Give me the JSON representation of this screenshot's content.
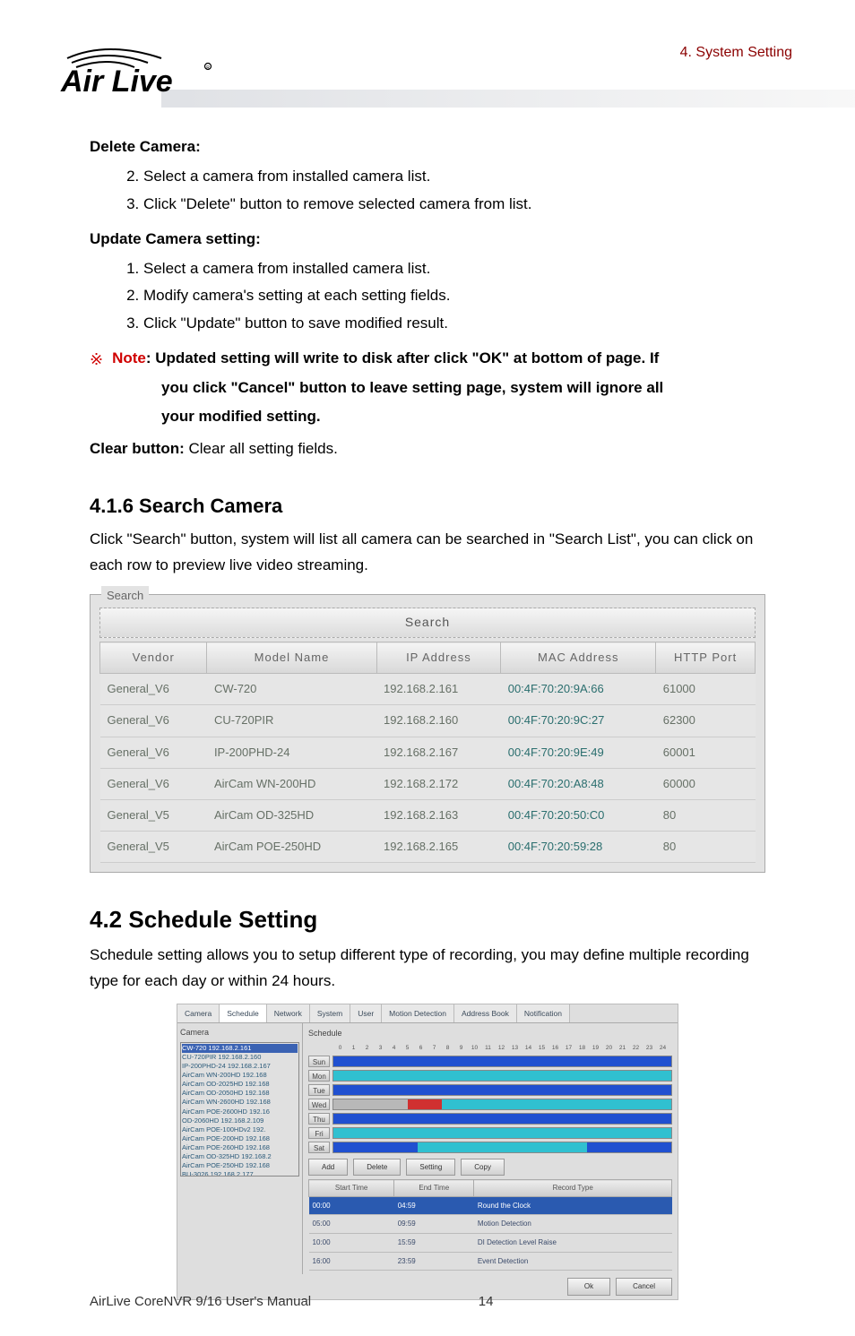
{
  "header": {
    "section_label": "4.  System Setting",
    "logo_text": "Air Live"
  },
  "delete_camera": {
    "title": "Delete Camera:",
    "steps": [
      "Select a camera from installed camera list.",
      "Click \"Delete\" button to remove selected camera from list."
    ]
  },
  "update_camera": {
    "title": "Update Camera setting:",
    "steps": [
      "Select a camera from installed camera list.",
      "Modify camera's setting at each setting fields.",
      "Click \"Update\" button to save modified result."
    ]
  },
  "note": {
    "symbol": "※",
    "label": "Note",
    "text_after_label": ": Updated setting will write to disk after click \"OK\" at bottom of page. If",
    "cont1": "you click \"Cancel\" button to leave setting page, system will ignore all",
    "cont2": "your modified setting."
  },
  "clear": {
    "label": "Clear button:",
    "text": " Clear all setting fields."
  },
  "search_section": {
    "heading": "4.1.6 Search Camera",
    "body": "Click \"Search\" button, system will list all camera can be searched in \"Search List\", you can click on each row to preview live video streaming."
  },
  "search_panel": {
    "legend": "Search",
    "button": "Search",
    "headers": [
      "Vendor",
      "Model Name",
      "IP Address",
      "MAC Address",
      "HTTP Port"
    ],
    "rows": [
      {
        "vendor": "General_V6",
        "model": "CW-720",
        "ip": "192.168.2.161",
        "mac": "00:4F:70:20:9A:66",
        "port": "61000"
      },
      {
        "vendor": "General_V6",
        "model": "CU-720PIR",
        "ip": "192.168.2.160",
        "mac": "00:4F:70:20:9C:27",
        "port": "62300"
      },
      {
        "vendor": "General_V6",
        "model": "IP-200PHD-24",
        "ip": "192.168.2.167",
        "mac": "00:4F:70:20:9E:49",
        "port": "60001"
      },
      {
        "vendor": "General_V6",
        "model": "AirCam WN-200HD",
        "ip": "192.168.2.172",
        "mac": "00:4F:70:20:A8:48",
        "port": "60000"
      },
      {
        "vendor": "General_V5",
        "model": "AirCam OD-325HD",
        "ip": "192.168.2.163",
        "mac": "00:4F:70:20:50:C0",
        "port": "80"
      },
      {
        "vendor": "General_V5",
        "model": "AirCam POE-250HD",
        "ip": "192.168.2.165",
        "mac": "00:4F:70:20:59:28",
        "port": "80"
      }
    ]
  },
  "schedule_section": {
    "heading": "4.2 Schedule Setting",
    "body": "Schedule setting allows you to setup different type of recording, you may define multiple recording type for each day or within 24 hours."
  },
  "schedule_fig": {
    "tabs": [
      "Camera",
      "Schedule",
      "Network",
      "System",
      "User",
      "Motion Detection",
      "Address Book",
      "Notification"
    ],
    "active_tab": 1,
    "left_title": "Camera",
    "cams": [
      "CW-720 192.168.2.161",
      "CU-720PIR 192.168.2.160",
      "IP-200PHD-24 192.168.2.167",
      "AirCam WN-200HD 192.168",
      "AirCam OD-2025HD 192.168",
      "AirCam OD-2050HD 192.168",
      "AirCam WN-2600HD 192.168",
      "AirCam POE-2600HD 192.16",
      "OD-2060HD 192.168.2.109",
      "AirCam POE-100HDv2 192.",
      "AirCam POE-200HD 192.168",
      "AirCam POE-260HD 192.168",
      "AirCam OD-325HD 192.168.2",
      "AirCam POE-250HD 192.168",
      "BU-3026 192.168.2.177"
    ],
    "right_title": "Schedule",
    "days": [
      "Sun",
      "Mon",
      "Tue",
      "Wed",
      "Thu",
      "Fri",
      "Sat"
    ],
    "btns": [
      "Add",
      "Delete",
      "Setting",
      "Copy"
    ],
    "tbl_headers": [
      "Start Time",
      "End Time",
      "Record Type"
    ],
    "tbl_rows": [
      {
        "start": "00:00",
        "end": "04:59",
        "type": "Round the Clock",
        "sel": true
      },
      {
        "start": "05:00",
        "end": "09:59",
        "type": "Motion Detection",
        "sel": false
      },
      {
        "start": "10:00",
        "end": "15:59",
        "type": "DI Detection Level Raise",
        "sel": false
      },
      {
        "start": "16:00",
        "end": "23:59",
        "type": "Event Detection",
        "sel": false
      }
    ],
    "ok": "Ok",
    "cancel": "Cancel"
  },
  "footer": {
    "title": "AirLive CoreNVR 9/16 User's Manual",
    "page": "14"
  }
}
